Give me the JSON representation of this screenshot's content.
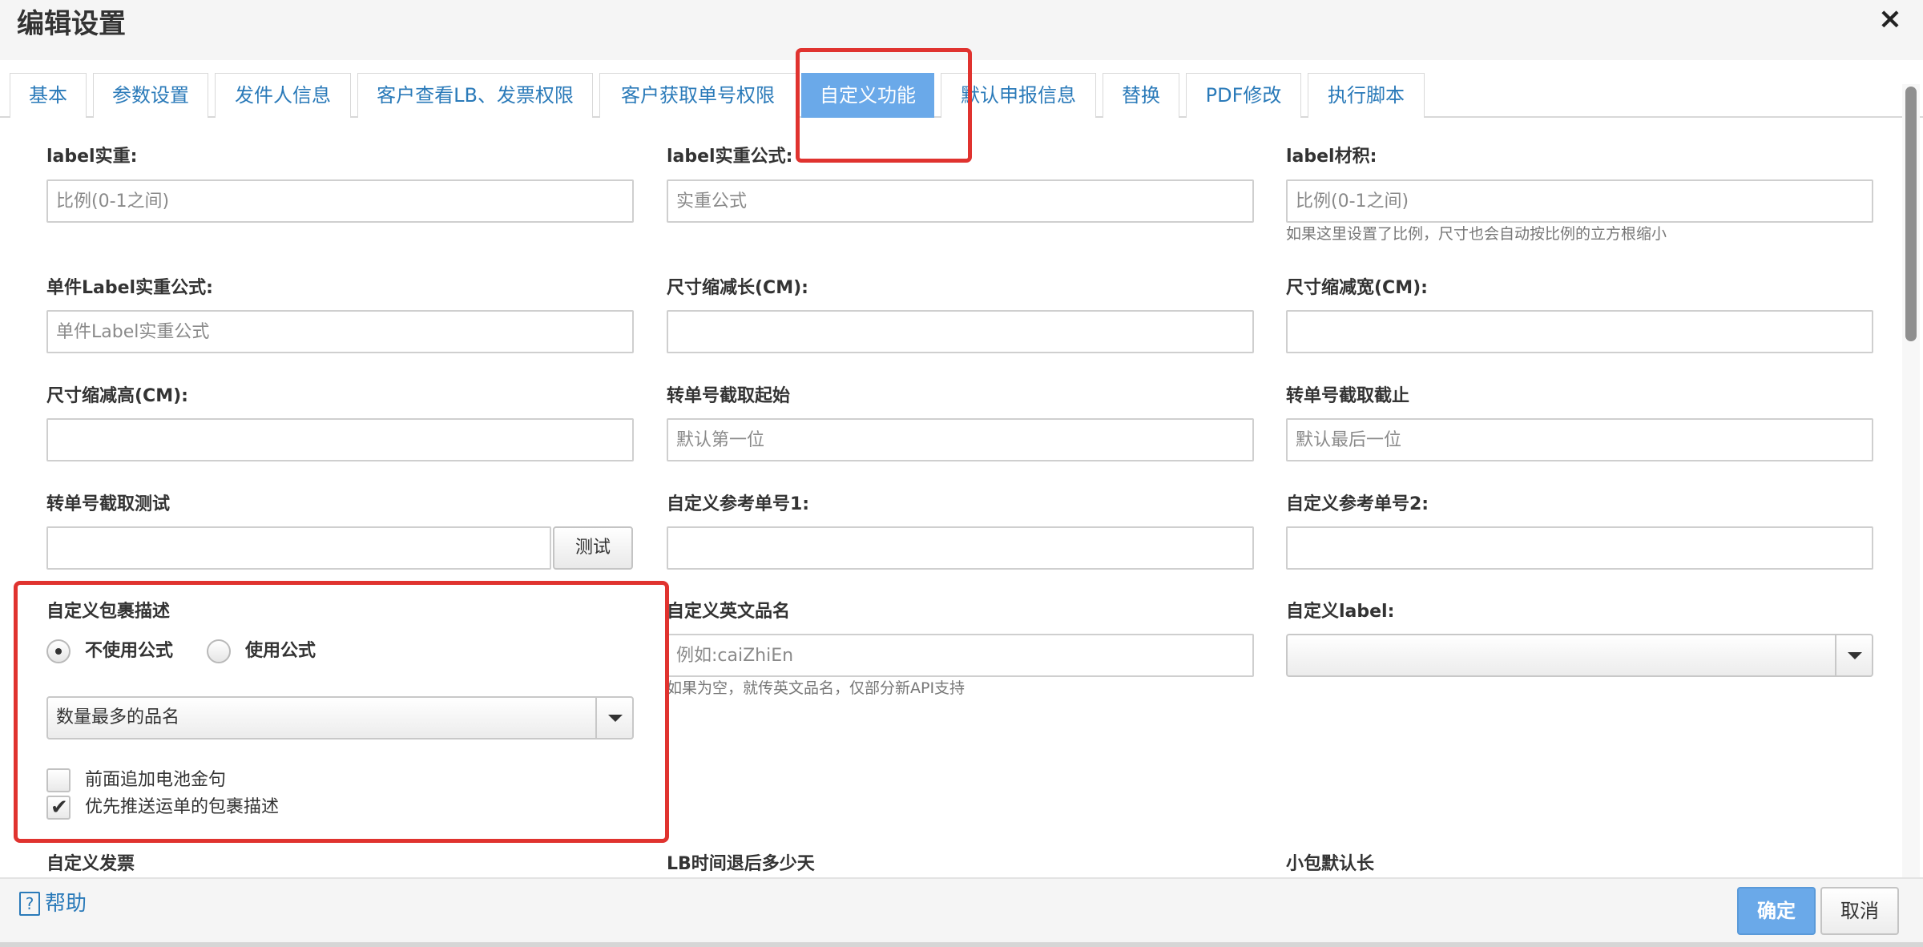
{
  "dialog": {
    "title": "编辑设置",
    "close": "×"
  },
  "tabs": [
    {
      "label": "基本"
    },
    {
      "label": "参数设置"
    },
    {
      "label": "发件人信息"
    },
    {
      "label": "客户查看LB、发票权限"
    },
    {
      "label": "客户获取单号权限"
    },
    {
      "label": "自定义功能",
      "active": true
    },
    {
      "label": "默认申报信息"
    },
    {
      "label": "替换"
    },
    {
      "label": "PDF修改"
    },
    {
      "label": "执行脚本"
    }
  ],
  "form": {
    "label_weight": {
      "label": "label实重:",
      "placeholder": "比例(0-1之间)"
    },
    "label_weight_formula": {
      "label": "label实重公式:",
      "placeholder": "实重公式"
    },
    "label_volume": {
      "label": "label材积:",
      "placeholder": "比例(0-1之间)",
      "help": "如果这里设置了比例，尺寸也会自动按比例的立方根缩小"
    },
    "single_label_formula": {
      "label": "单件Label实重公式:",
      "placeholder": "单件Label实重公式"
    },
    "size_reduce_length": {
      "label": "尺寸缩减长(CM):",
      "value": ""
    },
    "size_reduce_width": {
      "label": "尺寸缩减宽(CM):",
      "value": ""
    },
    "size_reduce_height": {
      "label": "尺寸缩减高(CM):",
      "value": ""
    },
    "tracking_cut_start": {
      "label": "转单号截取起始",
      "placeholder": "默认第一位"
    },
    "tracking_cut_end": {
      "label": "转单号截取截止",
      "placeholder": "默认最后一位"
    },
    "tracking_cut_test": {
      "label": "转单号截取测试",
      "value": "",
      "button": "测试"
    },
    "custom_ref1": {
      "label": "自定义参考单号1:",
      "value": ""
    },
    "custom_ref2": {
      "label": "自定义参考单号2:",
      "value": ""
    },
    "custom_package_desc": {
      "label": "自定义包裹描述",
      "radio_no_formula": "不使用公式",
      "radio_formula": "使用公式",
      "selected_radio": "不使用公式",
      "select_value": "数量最多的品名",
      "checkbox_battery": {
        "label": "前面追加电池金句",
        "checked": false
      },
      "checkbox_priority": {
        "label": "优先推送运单的包裹描述",
        "checked": true
      },
      "check_mark": "✔"
    },
    "custom_en_name": {
      "label": "自定义英文品名",
      "placeholder": "例如:caiZhiEn",
      "help": "如果为空，就传英文品名，仅部分新API支持"
    },
    "custom_label": {
      "label": "自定义label:",
      "value": ""
    },
    "custom_invoice": {
      "label": "自定义发票"
    },
    "lb_time_back": {
      "label": "LB时间退后多少天"
    },
    "packet_default_length": {
      "label": "小包默认长"
    }
  },
  "footer": {
    "help_icon": "?",
    "help": "帮助",
    "ok": "确定",
    "cancel": "取消"
  },
  "colors": {
    "accent": "#6aa9e9",
    "link": "#2a7ab9",
    "annotation": "#e0332f"
  }
}
